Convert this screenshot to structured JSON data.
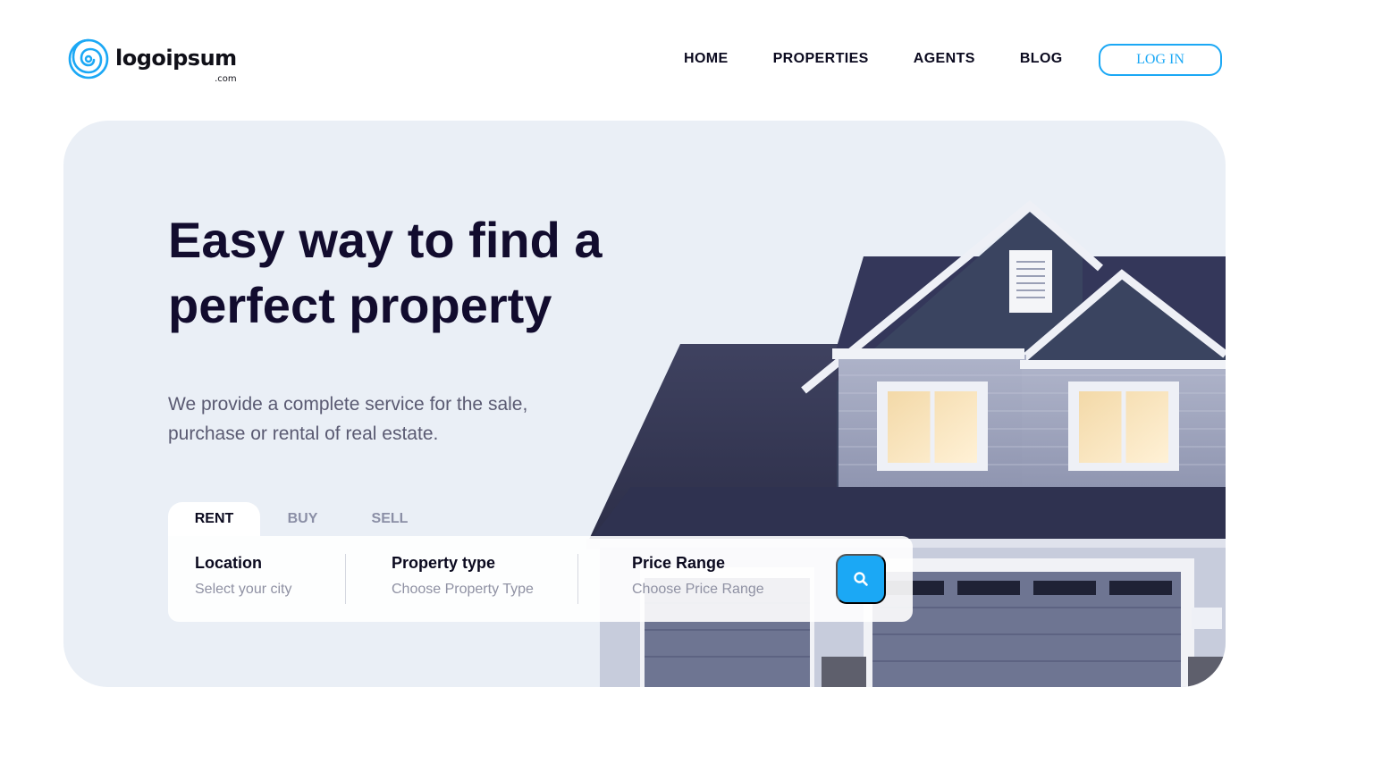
{
  "header": {
    "logo_name": "logoipsum",
    "logo_sub": ".com",
    "nav": {
      "home": "HOME",
      "properties": "PROPERTIES",
      "agents": "AGENTS",
      "blog": "BLOG"
    },
    "login_label": "LOG IN"
  },
  "hero": {
    "headline_line1": "Easy way to find a",
    "headline_line2": "perfect property",
    "subtext_line1": "We provide a complete service for the sale,",
    "subtext_line2": "purchase or rental of real estate."
  },
  "search": {
    "tabs": [
      "RENT",
      "BUY",
      "SELL"
    ],
    "active_tab": "RENT",
    "location": {
      "label": "Location",
      "value": "Select your city"
    },
    "property_type": {
      "label": "Property type",
      "value": "Choose Property Type"
    },
    "price_range": {
      "label": "Price Range",
      "value": "Choose Price Range"
    },
    "search_icon": "search-icon"
  },
  "colors": {
    "accent": "#1ba8f5",
    "heading": "#120c2e",
    "hero_bg": "#eaeff6"
  }
}
